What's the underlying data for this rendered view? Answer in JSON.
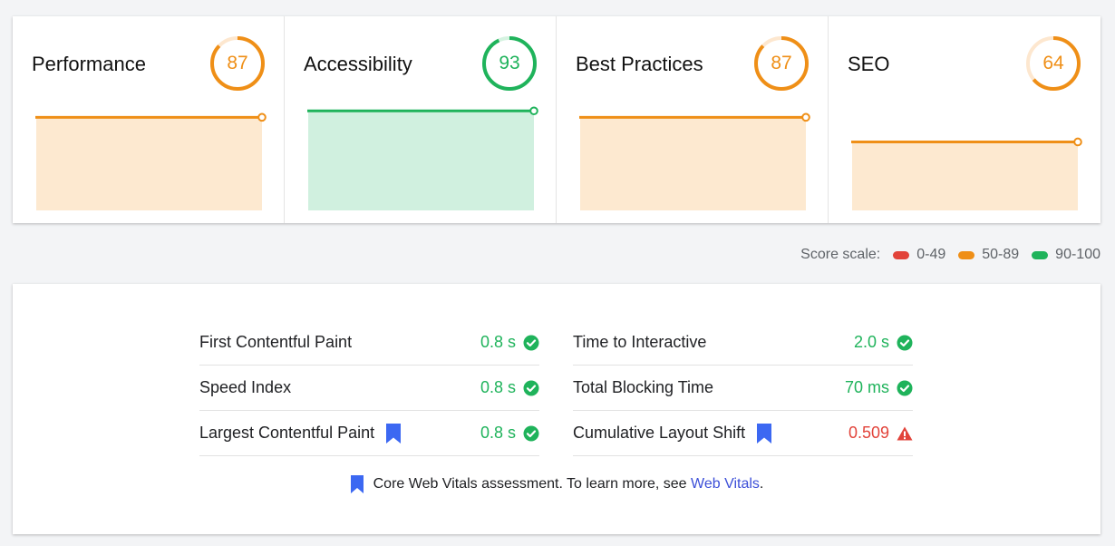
{
  "colors": {
    "orange": "#ef8f17",
    "orange_light": "#fde9d0",
    "orange_track": "#fde7cf",
    "green": "#1fb35b",
    "green_light": "#d0f0df",
    "green_track": "#d6f3e1",
    "red": "#e2433a",
    "blue_bookmark": "#3c68f2",
    "link": "#3c4fd8"
  },
  "categories": [
    {
      "title": "Performance",
      "score": "87",
      "score_value": 87,
      "rating": "average",
      "trend_level": 0.87
    },
    {
      "title": "Accessibility",
      "score": "93",
      "score_value": 93,
      "rating": "pass",
      "trend_level": 0.93
    },
    {
      "title": "Best Practices",
      "score": "87",
      "score_value": 87,
      "rating": "average",
      "trend_level": 0.87
    },
    {
      "title": "SEO",
      "score": "64",
      "score_value": 64,
      "rating": "average",
      "trend_level": 0.64
    }
  ],
  "score_scale": {
    "label": "Score scale:",
    "ranges": [
      {
        "label": "0-49",
        "color": "#e2433a"
      },
      {
        "label": "50-89",
        "color": "#ef8f17"
      },
      {
        "label": "90-100",
        "color": "#1fb35b"
      }
    ]
  },
  "metrics": {
    "left": [
      {
        "label": "First Contentful Paint",
        "value": "0.8 s",
        "status": "pass",
        "core_vital": false
      },
      {
        "label": "Speed Index",
        "value": "0.8 s",
        "status": "pass",
        "core_vital": false
      },
      {
        "label": "Largest Contentful Paint",
        "value": "0.8 s",
        "status": "pass",
        "core_vital": true
      }
    ],
    "right": [
      {
        "label": "Time to Interactive",
        "value": "2.0 s",
        "status": "pass",
        "core_vital": false
      },
      {
        "label": "Total Blocking Time",
        "value": "70 ms",
        "status": "pass",
        "core_vital": false
      },
      {
        "label": "Cumulative Layout Shift",
        "value": "0.509",
        "status": "fail",
        "core_vital": true
      }
    ]
  },
  "footer": {
    "text": "Core Web Vitals assessment. To learn more, see ",
    "link_text": "Web Vitals",
    "suffix": "."
  }
}
